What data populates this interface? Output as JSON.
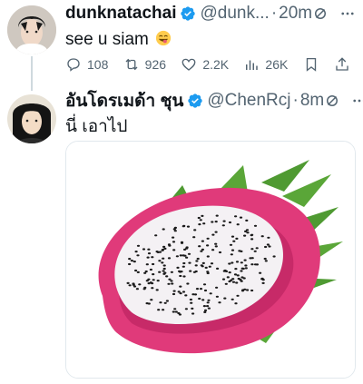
{
  "tweets": [
    {
      "display_name": "dunknatachai",
      "handle": "@dunk...",
      "time": "20m",
      "separator": "·",
      "text": "see u siam",
      "emoji": "smiling-face-with-tongue",
      "actions": {
        "replies": "108",
        "reposts": "926",
        "likes": "2.2K",
        "views": "26K"
      }
    },
    {
      "display_name": "อันโดรเมด้า ชุน",
      "handle": "@ChenRcj",
      "time": "8m",
      "separator": "·",
      "text": "นี่ เอาไป",
      "media": "dragon-fruit-photo"
    }
  ],
  "colors": {
    "verified": "#1d9bf0",
    "secondary_text": "#536471",
    "thread_line": "#cfd9de"
  }
}
